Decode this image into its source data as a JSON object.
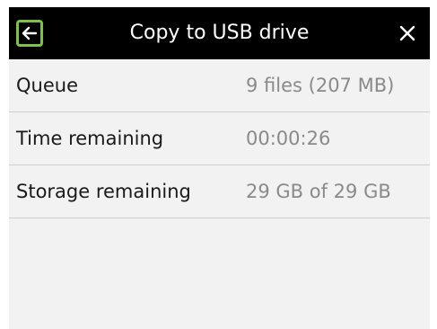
{
  "titlebar": {
    "title": "Copy to USB drive",
    "back_icon": "arrow-left-icon",
    "close_icon": "close-icon",
    "accent_color": "#7dc242"
  },
  "rows": [
    {
      "label": "Queue",
      "value": "9 files (207 MB)"
    },
    {
      "label": "Time remaining",
      "value": "00:00:26"
    },
    {
      "label": "Storage remaining",
      "value": "29 GB of 29 GB"
    }
  ]
}
